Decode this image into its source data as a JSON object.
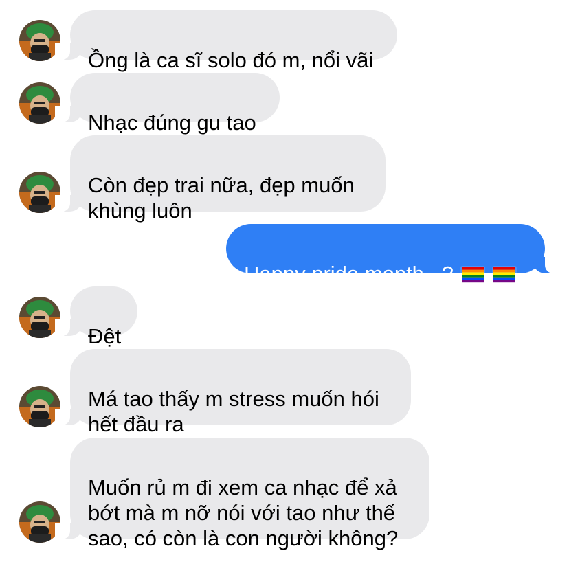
{
  "colors": {
    "incoming_bubble": "#e9e9eb",
    "outgoing_bubble": "#2f7ff5",
    "incoming_text": "#000000",
    "outgoing_text": "#ffffff"
  },
  "messages": [
    {
      "direction": "incoming",
      "text": "Ồng là ca sĩ solo đó m, nổi vãi"
    },
    {
      "direction": "incoming",
      "text": "Nhạc đúng gu tao"
    },
    {
      "direction": "incoming",
      "text": "Còn đẹp trai nữa, đẹp muốn\nkhùng luôn"
    },
    {
      "direction": "outgoing",
      "text": "Happy pride month...?",
      "emoji": [
        "rainbow-flag-icon",
        "rainbow-flag-icon"
      ]
    },
    {
      "direction": "incoming",
      "text": "Đệt"
    },
    {
      "direction": "incoming",
      "text": "Má tao thấy m stress muốn hói\nhết đầu ra"
    },
    {
      "direction": "incoming",
      "text": "Muốn rủ m đi xem ca nhạc để xả\nbớt mà m nỡ nói với tao như thế\nsao, có còn là con người không?"
    }
  ],
  "avatar_icon": "contact-avatar-icon"
}
